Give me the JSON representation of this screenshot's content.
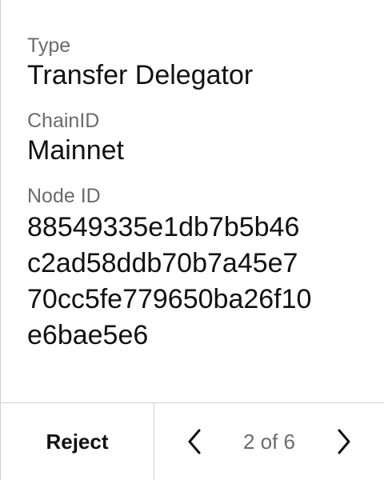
{
  "fields": [
    {
      "label": "Type",
      "value": "Transfer Delegator"
    },
    {
      "label": "ChainID",
      "value": "Mainnet"
    },
    {
      "label": "Node ID",
      "value_lines": [
        "88549335e1db7b5b46",
        "c2ad58ddb70b7a45e7",
        "70cc5fe779650ba26f10",
        "e6bae5e6"
      ]
    }
  ],
  "footer": {
    "reject_label": "Reject",
    "page_indicator": "2 of 6",
    "prev_icon": "chevron-left-icon",
    "next_icon": "chevron-right-icon"
  }
}
